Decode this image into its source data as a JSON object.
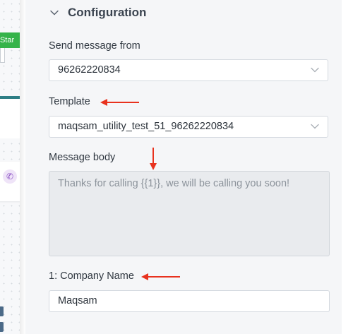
{
  "canvas": {
    "node_label": "ll Star"
  },
  "configuration": {
    "title": "Configuration",
    "send_from": {
      "label": "Send message from",
      "value": "96262220834"
    },
    "template": {
      "label": "Template",
      "value": "maqsam_utility_test_51_96262220834"
    },
    "message_body": {
      "label": "Message body",
      "value": "Thanks for calling {{1}}, we will be calling you soon!"
    },
    "variable_1": {
      "label": "1: Company Name",
      "value": "Maqsam"
    }
  },
  "annotation_color": "#e8321e",
  "icons": [
    "chevron-down-icon",
    "dropdown-caret-icon",
    "phone-icon",
    "red-arrow-annotation"
  ]
}
